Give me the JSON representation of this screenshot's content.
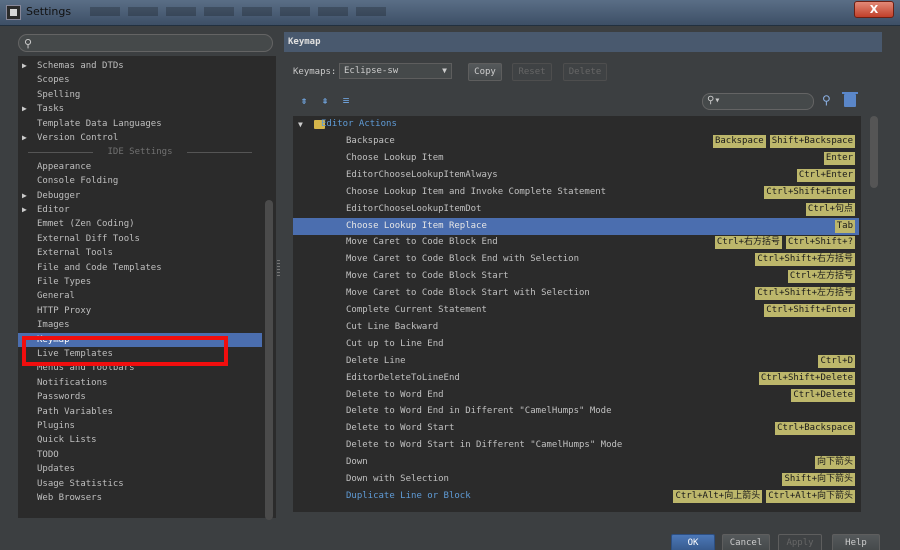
{
  "window": {
    "title": "Settings",
    "close_label": "X"
  },
  "sidebar": {
    "section_label": "IDE Settings",
    "items": [
      {
        "label": "Schemas and DTDs",
        "arrow": "▶"
      },
      {
        "label": "Scopes",
        "arrow": ""
      },
      {
        "label": "Spelling",
        "arrow": ""
      },
      {
        "label": "Tasks",
        "arrow": "▶"
      },
      {
        "label": "Template Data Languages",
        "arrow": ""
      },
      {
        "label": "Version Control",
        "arrow": "▶"
      },
      {
        "label": "Appearance",
        "arrow": ""
      },
      {
        "label": "Console Folding",
        "arrow": ""
      },
      {
        "label": "Debugger",
        "arrow": "▶"
      },
      {
        "label": "Editor",
        "arrow": "▶"
      },
      {
        "label": "Emmet (Zen Coding)",
        "arrow": ""
      },
      {
        "label": "External Diff Tools",
        "arrow": ""
      },
      {
        "label": "External Tools",
        "arrow": ""
      },
      {
        "label": "File and Code Templates",
        "arrow": ""
      },
      {
        "label": "File Types",
        "arrow": ""
      },
      {
        "label": "General",
        "arrow": ""
      },
      {
        "label": "HTTP Proxy",
        "arrow": ""
      },
      {
        "label": "Images",
        "arrow": ""
      },
      {
        "label": "Keymap",
        "arrow": ""
      },
      {
        "label": "Live Templates",
        "arrow": ""
      },
      {
        "label": "Menus and Toolbars",
        "arrow": ""
      },
      {
        "label": "Notifications",
        "arrow": ""
      },
      {
        "label": "Passwords",
        "arrow": ""
      },
      {
        "label": "Path Variables",
        "arrow": ""
      },
      {
        "label": "Plugins",
        "arrow": ""
      },
      {
        "label": "Quick Lists",
        "arrow": ""
      },
      {
        "label": "TODO",
        "arrow": ""
      },
      {
        "label": "Updates",
        "arrow": ""
      },
      {
        "label": "Usage Statistics",
        "arrow": ""
      },
      {
        "label": "Web Browsers",
        "arrow": ""
      }
    ]
  },
  "keymap": {
    "header": "Keymap",
    "label": "Keymaps:",
    "selected": "Eclipse-sw",
    "copy_label": "Copy",
    "reset_label": "Reset",
    "delete_label": "Delete",
    "group": "Editor Actions",
    "rows": [
      {
        "action": "Backspace",
        "shortcuts": [
          "Backspace",
          "Shift+Backspace"
        ]
      },
      {
        "action": "Choose Lookup Item",
        "shortcuts": [
          "Enter"
        ]
      },
      {
        "action": "EditorChooseLookupItemAlways",
        "shortcuts": [
          "Ctrl+Enter"
        ]
      },
      {
        "action": "Choose Lookup Item and Invoke Complete Statement",
        "shortcuts": [
          "Ctrl+Shift+Enter"
        ]
      },
      {
        "action": "EditorChooseLookupItemDot",
        "shortcuts": [
          "Ctrl+句点"
        ]
      },
      {
        "action": "Choose Lookup Item Replace",
        "shortcuts": [
          "Tab"
        ]
      },
      {
        "action": "Move Caret to Code Block End",
        "shortcuts": [
          "Ctrl+右方括号",
          "Ctrl+Shift+?"
        ]
      },
      {
        "action": "Move Caret to Code Block End with Selection",
        "shortcuts": [
          "Ctrl+Shift+右方括号"
        ]
      },
      {
        "action": "Move Caret to Code Block Start",
        "shortcuts": [
          "Ctrl+左方括号"
        ]
      },
      {
        "action": "Move Caret to Code Block Start with Selection",
        "shortcuts": [
          "Ctrl+Shift+左方括号"
        ]
      },
      {
        "action": "Complete Current Statement",
        "shortcuts": [
          "Ctrl+Shift+Enter"
        ]
      },
      {
        "action": "Cut Line Backward",
        "shortcuts": []
      },
      {
        "action": "Cut up to Line End",
        "shortcuts": []
      },
      {
        "action": "Delete Line",
        "shortcuts": [
          "Ctrl+D"
        ]
      },
      {
        "action": "EditorDeleteToLineEnd",
        "shortcuts": [
          "Ctrl+Shift+Delete"
        ]
      },
      {
        "action": "Delete to Word End",
        "shortcuts": [
          "Ctrl+Delete"
        ]
      },
      {
        "action": "Delete to Word End in Different \"CamelHumps\" Mode",
        "shortcuts": []
      },
      {
        "action": "Delete to Word Start",
        "shortcuts": [
          "Ctrl+Backspace"
        ]
      },
      {
        "action": "Delete to Word Start in Different \"CamelHumps\" Mode",
        "shortcuts": []
      },
      {
        "action": "Down",
        "shortcuts": [
          "向下箭头"
        ]
      },
      {
        "action": "Down with Selection",
        "shortcuts": [
          "Shift+向下箭头"
        ]
      },
      {
        "action": "Duplicate Line or Block",
        "shortcuts": [
          "Ctrl+Alt+向上箭头",
          "Ctrl+Alt+向下箭头"
        ]
      }
    ]
  },
  "footer": {
    "ok": "OK",
    "cancel": "Cancel",
    "apply": "Apply",
    "help": "Help"
  },
  "colors": {
    "selection": "#4b6eaf",
    "shortcut_bg": "#bdb76b",
    "highlight": "#f10e0e",
    "header": "#49596e"
  }
}
